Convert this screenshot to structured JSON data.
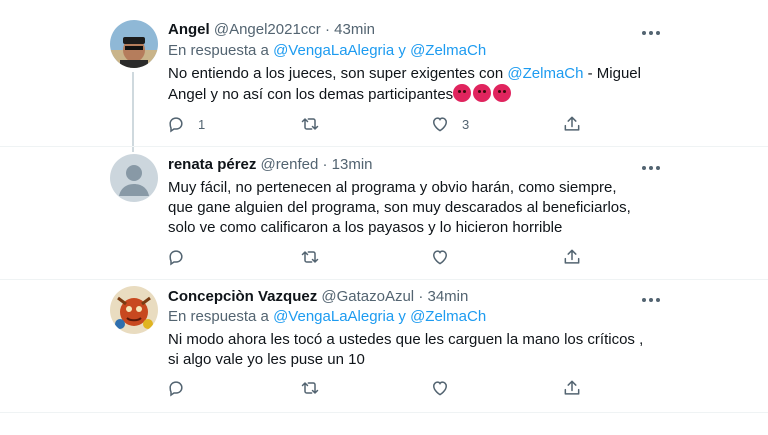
{
  "tweets": [
    {
      "name": "Angel",
      "handle": "@Angel2021ccr",
      "time": "43min",
      "reply_prefix": "En respuesta a",
      "reply_user1": "@VengaLaAlegria",
      "reply_joiner": "y",
      "reply_user2": "@ZelmaCh",
      "body_line1_prefix": "No entiendo a los jueces, son super exigentes con ",
      "body_line1_mention": "@ZelmaCh",
      "body_line1_suffix": " -  Miguel",
      "body_line2": "Angel y no así con los demas participantes",
      "emojis": [
        "angry-face-icon",
        "angry-face-icon",
        "angry-face-icon"
      ],
      "reply_count": "1",
      "retweet_count": "",
      "like_count": "3"
    },
    {
      "name": "renata pérez",
      "handle": "@renfed",
      "time": "13min",
      "body_line1": "Muy fácil, no pertenecen al programa y obvio harán, como siempre,",
      "body_line2": "que gane alguien del programa, son muy descarados al beneficiarlos,",
      "body_line3": "solo ve como calificaron a los payasos y lo hicieron horrible",
      "reply_count": "",
      "retweet_count": "",
      "like_count": ""
    },
    {
      "name": "Concepciòn Vazquez",
      "handle": "@GatazoAzul",
      "time": "34min",
      "reply_prefix": "En respuesta a",
      "reply_user1": "@VengaLaAlegria",
      "reply_joiner": "y",
      "reply_user2": "@ZelmaCh",
      "body_line1": "Ni modo ahora les tocó a ustedes que les carguen la mano los críticos ,",
      "body_line2": "si algo vale yo les puse un 10",
      "reply_count": "",
      "retweet_count": "",
      "like_count": ""
    }
  ],
  "colors": {
    "link": "#1d9bf0",
    "secondary_text": "#536471",
    "divider": "#eff3f4"
  }
}
